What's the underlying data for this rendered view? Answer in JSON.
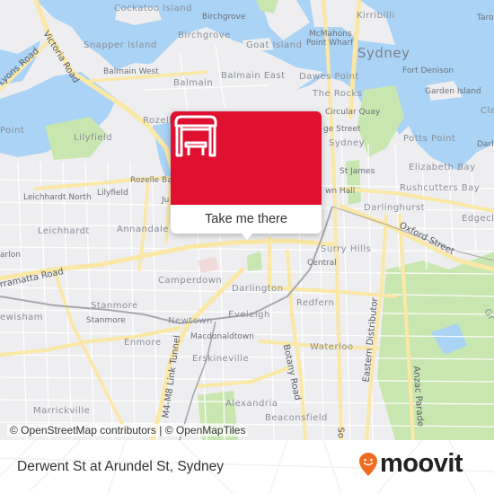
{
  "map": {
    "colors": {
      "land": "#eeeef0",
      "water": "#aad3f5",
      "park": "#c8e6b0",
      "major_road": "#fbe7a6",
      "minor_road": "#ffffff",
      "rail": "#a0a0a0"
    },
    "place_labels": [
      {
        "text": "Cockatoo Island",
        "kind": "md"
      },
      {
        "text": "Birchgrove",
        "kind": "sm"
      },
      {
        "text": "Kirribilli",
        "kind": "md"
      },
      {
        "text": "Birchgrove",
        "kind": "md"
      },
      {
        "text": "McMahons",
        "kind": "sm"
      },
      {
        "text": "Point Wharf",
        "kind": "sm"
      },
      {
        "text": "Snapper Island",
        "kind": "md"
      },
      {
        "text": "Goat Island",
        "kind": "md"
      },
      {
        "text": "Sydney",
        "kind": "lg"
      },
      {
        "text": "Balmain West",
        "kind": "sm"
      },
      {
        "text": "Balmain East",
        "kind": "md"
      },
      {
        "text": "Fort Denison",
        "kind": "sm"
      },
      {
        "text": "Balmain",
        "kind": "md"
      },
      {
        "text": "Dawes Point",
        "kind": "md"
      },
      {
        "text": "Garden Island",
        "kind": "sm"
      },
      {
        "text": "The Rocks",
        "kind": "md"
      },
      {
        "text": "Rozelle",
        "kind": "md"
      },
      {
        "text": "Circular Quay",
        "kind": "sm"
      },
      {
        "text": "Point",
        "kind": "md"
      },
      {
        "text": "ge Street",
        "kind": "sm"
      },
      {
        "text": "Potts Point",
        "kind": "md"
      },
      {
        "text": "Sydney",
        "kind": "md"
      },
      {
        "text": "Lilyfield",
        "kind": "md"
      },
      {
        "text": "Darli",
        "kind": "sm"
      },
      {
        "text": "St James",
        "kind": "sm"
      },
      {
        "text": "Elizabeth Bay",
        "kind": "md"
      },
      {
        "text": "Rozelle Bay",
        "kind": "sm"
      },
      {
        "text": "Leichhardt North",
        "kind": "sm"
      },
      {
        "text": "Lilyfield",
        "kind": "sm"
      },
      {
        "text": "Ju",
        "kind": "sm"
      },
      {
        "text": "wn Hall",
        "kind": "sm"
      },
      {
        "text": "Rushcutters Bay",
        "kind": "md"
      },
      {
        "text": "Darlinghurst",
        "kind": "md"
      },
      {
        "text": "Edgecl",
        "kind": "md"
      },
      {
        "text": "Leichhardt",
        "kind": "md"
      },
      {
        "text": "Annandale",
        "kind": "md"
      },
      {
        "text": "Surry Hills",
        "kind": "md"
      },
      {
        "text": "arlon",
        "kind": "sm"
      },
      {
        "text": "Central",
        "kind": "sm"
      },
      {
        "text": "Camperdown",
        "kind": "md"
      },
      {
        "text": "Darlington",
        "kind": "md"
      },
      {
        "text": "Redfern",
        "kind": "md"
      },
      {
        "text": "Stanmore",
        "kind": "md"
      },
      {
        "text": "ewisham",
        "kind": "md"
      },
      {
        "text": "Stanmore",
        "kind": "sm"
      },
      {
        "text": "Newtown",
        "kind": "md"
      },
      {
        "text": "Eveleigh",
        "kind": "md"
      },
      {
        "text": "Macdonaldtown",
        "kind": "sm"
      },
      {
        "text": "Enmore",
        "kind": "md"
      },
      {
        "text": "Waterloo",
        "kind": "md"
      },
      {
        "text": "Erskineville",
        "kind": "md"
      },
      {
        "text": "Alexandria",
        "kind": "md"
      },
      {
        "text": "Marrickville",
        "kind": "md"
      },
      {
        "text": "Beaconsfield",
        "kind": "md"
      },
      {
        "text": "Taro",
        "kind": "sm"
      },
      {
        "text": "Cla",
        "kind": "md"
      },
      {
        "text": "Gr",
        "kind": "md"
      }
    ],
    "road_labels": [
      "Victoria Road",
      "Lyons Road",
      "rramatta Road",
      "Oxford Street",
      "M4-M8 Link Tunnel",
      "Botany Road",
      "Eastern Distributor",
      "Anzac Parade",
      "So"
    ]
  },
  "popup": {
    "icon": "bus-stop-shelter-icon",
    "header_color": "#e01030",
    "action_label": "Take me there"
  },
  "attribution": "© OpenStreetMap contributors | © OpenMapTiles",
  "footer": {
    "stop_name": "Derwent St at Arundel St, Sydney",
    "brand": {
      "name": "moovit",
      "pin_color": "#f26b21"
    }
  }
}
